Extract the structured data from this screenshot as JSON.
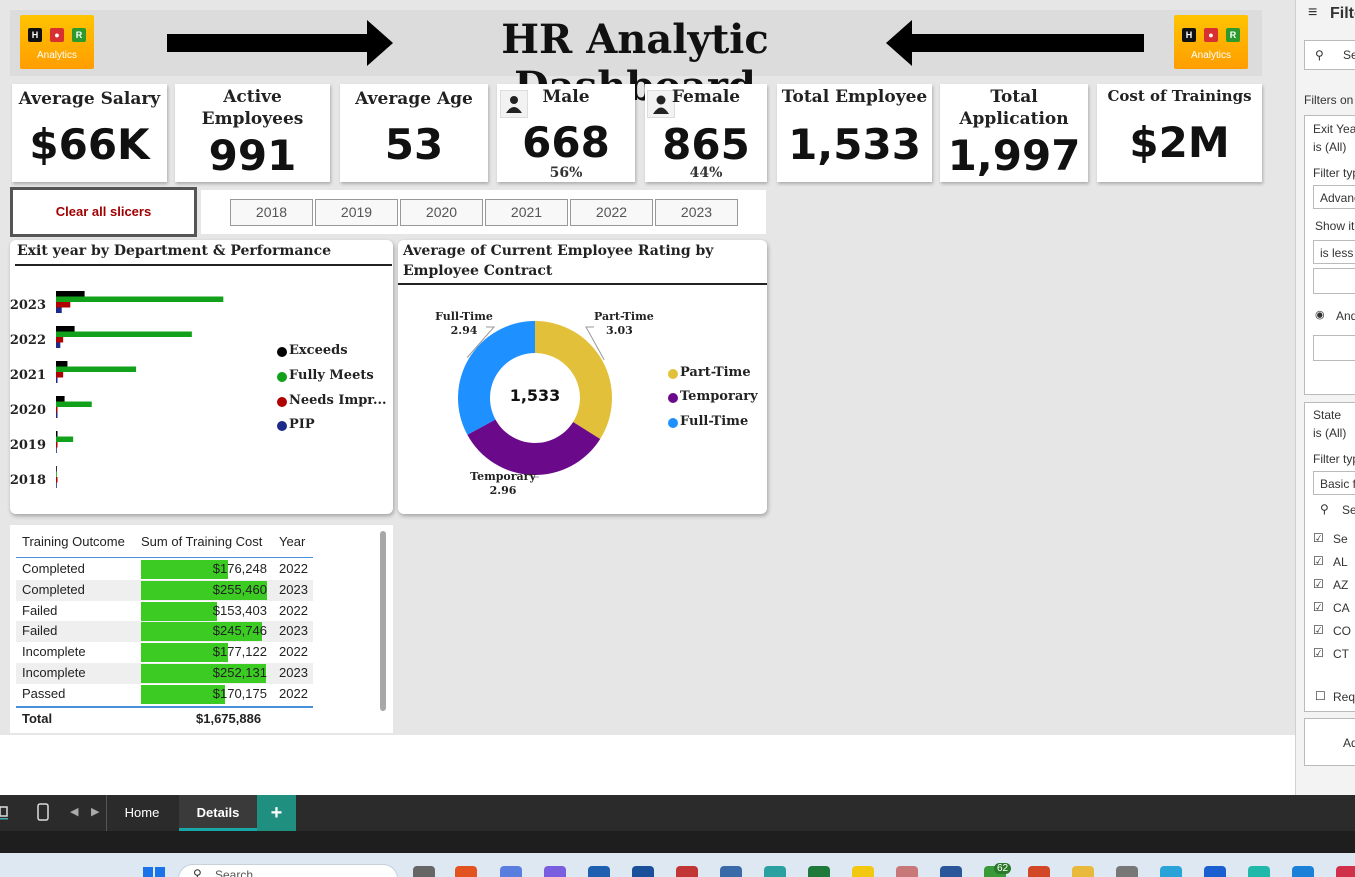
{
  "header": {
    "title": "HR Analytic Dashboard",
    "logo_text": "Analytics",
    "logo_letters": [
      "H",
      "R"
    ]
  },
  "kpis": {
    "avg_salary": {
      "label": "Average Salary",
      "value": "$66K"
    },
    "active": {
      "label": "Active Employees",
      "value": "991"
    },
    "avg_age": {
      "label": "Average Age",
      "value": "53"
    },
    "male": {
      "label": "Male",
      "value": "668",
      "pct": "56%"
    },
    "female": {
      "label": "Female",
      "value": "865",
      "pct": "44%"
    },
    "total_emp": {
      "label": "Total Employee",
      "value": "1,533"
    },
    "total_app": {
      "label": "Total Application",
      "value": "1,997"
    },
    "cost": {
      "label": "Cost of Trainings",
      "value": "$2M"
    }
  },
  "slicer": {
    "clear_label": "Clear all slicers",
    "years": [
      "2018",
      "2019",
      "2020",
      "2021",
      "2022",
      "2023"
    ]
  },
  "colors": {
    "exceeds": "#000000",
    "fully_meets": "#11a11a",
    "needs_impr": "#b00000",
    "pip": "#1c2a8a",
    "part_time": "#e2c03a",
    "temporary": "#6a0a8a",
    "full_time": "#1e90ff",
    "table_bar": "#3bcb23"
  },
  "chart_data": [
    {
      "type": "bar",
      "title": "Exit year by Department & Performance",
      "categories": [
        "2023",
        "2022",
        "2021",
        "2020",
        "2019",
        "2018"
      ],
      "series": [
        {
          "name": "Exceeds",
          "values": [
            20,
            13,
            8,
            6,
            1,
            0
          ]
        },
        {
          "name": "Fully Meets",
          "values": [
            117,
            95,
            56,
            25,
            12,
            0
          ]
        },
        {
          "name": "Needs Impr...",
          "values": [
            10,
            5,
            5,
            1,
            1,
            1
          ]
        },
        {
          "name": "PIP",
          "values": [
            4,
            3,
            1,
            1,
            0,
            0
          ]
        }
      ],
      "orientation": "horizontal",
      "legend": "right"
    },
    {
      "type": "pie",
      "title": "Average of Current Employee Rating by Employee Contract",
      "center_label": "1,533",
      "slices": [
        {
          "name": "Part-Time",
          "value": 3.03
        },
        {
          "name": "Temporary",
          "value": 2.96
        },
        {
          "name": "Full-Time",
          "value": 2.94
        }
      ],
      "data_labels": [
        {
          "name": "Part-Time",
          "value": "3.03"
        },
        {
          "name": "Temporary",
          "value": "2.96"
        },
        {
          "name": "Full-Time",
          "value": "2.94"
        }
      ],
      "legend": "right"
    }
  ],
  "training_table": {
    "headers": [
      "Training Outcome",
      "Sum of Training Cost",
      "Year"
    ],
    "rows": [
      {
        "outcome": "Completed",
        "cost": "$176,248",
        "year": "2022",
        "fill": 0.69
      },
      {
        "outcome": "Completed",
        "cost": "$255,460",
        "year": "2023",
        "fill": 1.0
      },
      {
        "outcome": "Failed",
        "cost": "$153,403",
        "year": "2022",
        "fill": 0.6
      },
      {
        "outcome": "Failed",
        "cost": "$245,746",
        "year": "2023",
        "fill": 0.96
      },
      {
        "outcome": "Incomplete",
        "cost": "$177,122",
        "year": "2022",
        "fill": 0.69
      },
      {
        "outcome": "Incomplete",
        "cost": "$252,131",
        "year": "2023",
        "fill": 0.99
      },
      {
        "outcome": "Passed",
        "cost": "$170,175",
        "year": "2022",
        "fill": 0.67
      }
    ],
    "total_label": "Total",
    "total_value": "$1,675,886"
  },
  "filters_pane": {
    "title": "Filte",
    "search": "Se",
    "filters_on": "Filters on",
    "exit_year": "Exit Year",
    "is_all": "is (All)",
    "filter_type": "Filter typ",
    "advanced": "Advanc",
    "show_items": "Show ite",
    "is_less": "is less",
    "and": "And",
    "state": "State",
    "state_is_all": "is (All)",
    "filter_type2": "Filter typ",
    "basic": "Basic fi",
    "search2": "Se",
    "states": [
      "Se",
      "AL",
      "AZ",
      "CA",
      "CO",
      "CT"
    ],
    "require": "Requ",
    "add": "Ad"
  },
  "tabs": {
    "home": "Home",
    "details": "Details",
    "add": "+"
  },
  "taskbar": {
    "search": "Search",
    "badge": "62"
  }
}
